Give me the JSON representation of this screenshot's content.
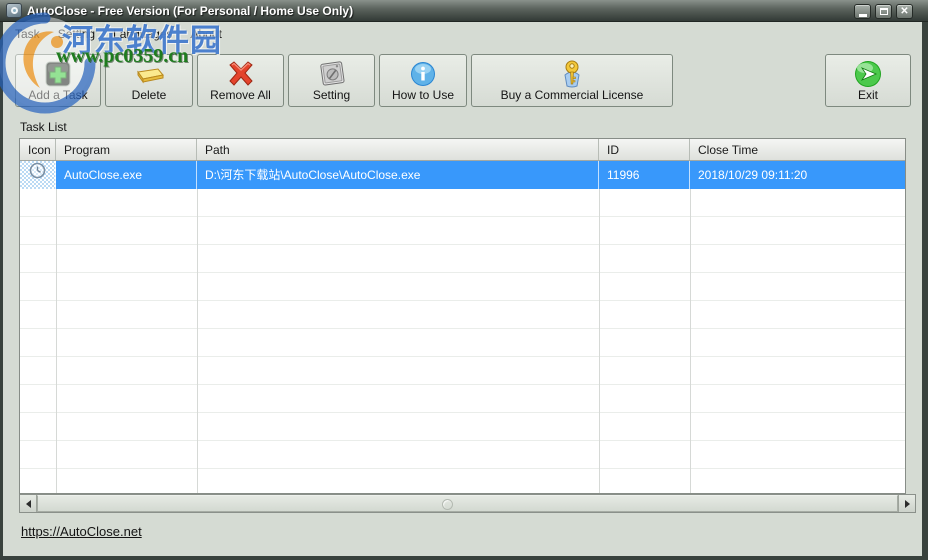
{
  "window": {
    "title": "AutoClose - Free Version (For Personal / Home Use Only)",
    "controls": [
      {
        "icon": "minimize-icon"
      },
      {
        "icon": "maximize-icon"
      },
      {
        "icon": "close-icon"
      }
    ]
  },
  "menu": {
    "items": [
      {
        "label": "Task"
      },
      {
        "label": "Setting"
      },
      {
        "label": "Languages"
      },
      {
        "label": "About"
      }
    ]
  },
  "toolbar": {
    "buttons": [
      {
        "label": "Add a Task",
        "icon": "add-task-icon"
      },
      {
        "label": "Delete",
        "icon": "delete-icon"
      },
      {
        "label": "Remove All",
        "icon": "remove-all-icon"
      },
      {
        "label": "Setting",
        "icon": "setting-icon"
      },
      {
        "label": "How to Use",
        "icon": "how-to-use-icon"
      },
      {
        "label": "Buy a Commercial License",
        "icon": "buy-license-icon"
      },
      {
        "label": "Exit",
        "icon": "exit-icon"
      }
    ]
  },
  "task_list": {
    "section_label": "Task List",
    "columns": [
      {
        "label": "Icon"
      },
      {
        "label": "Program"
      },
      {
        "label": "Path"
      },
      {
        "label": "ID"
      },
      {
        "label": "Close Time"
      }
    ],
    "rows": [
      {
        "icon": "clock-icon",
        "program": "AutoClose.exe",
        "path": "D:\\河东下载站\\AutoClose\\AutoClose.exe",
        "id": "11996",
        "close_time": "2018/10/29 09:11:20",
        "selected": true
      }
    ]
  },
  "footer": {
    "link_text": "https://AutoClose.net"
  },
  "watermarks": {
    "brand": "河东软件园",
    "site": "www.pc0359.cn"
  },
  "colors": {
    "selection_blue": "#3898fb",
    "client_bg": "#d5dbd3",
    "titlebar_dark": "#323a36",
    "watermark_blue": "#2666c4",
    "watermark_green": "#1e7c1e"
  }
}
